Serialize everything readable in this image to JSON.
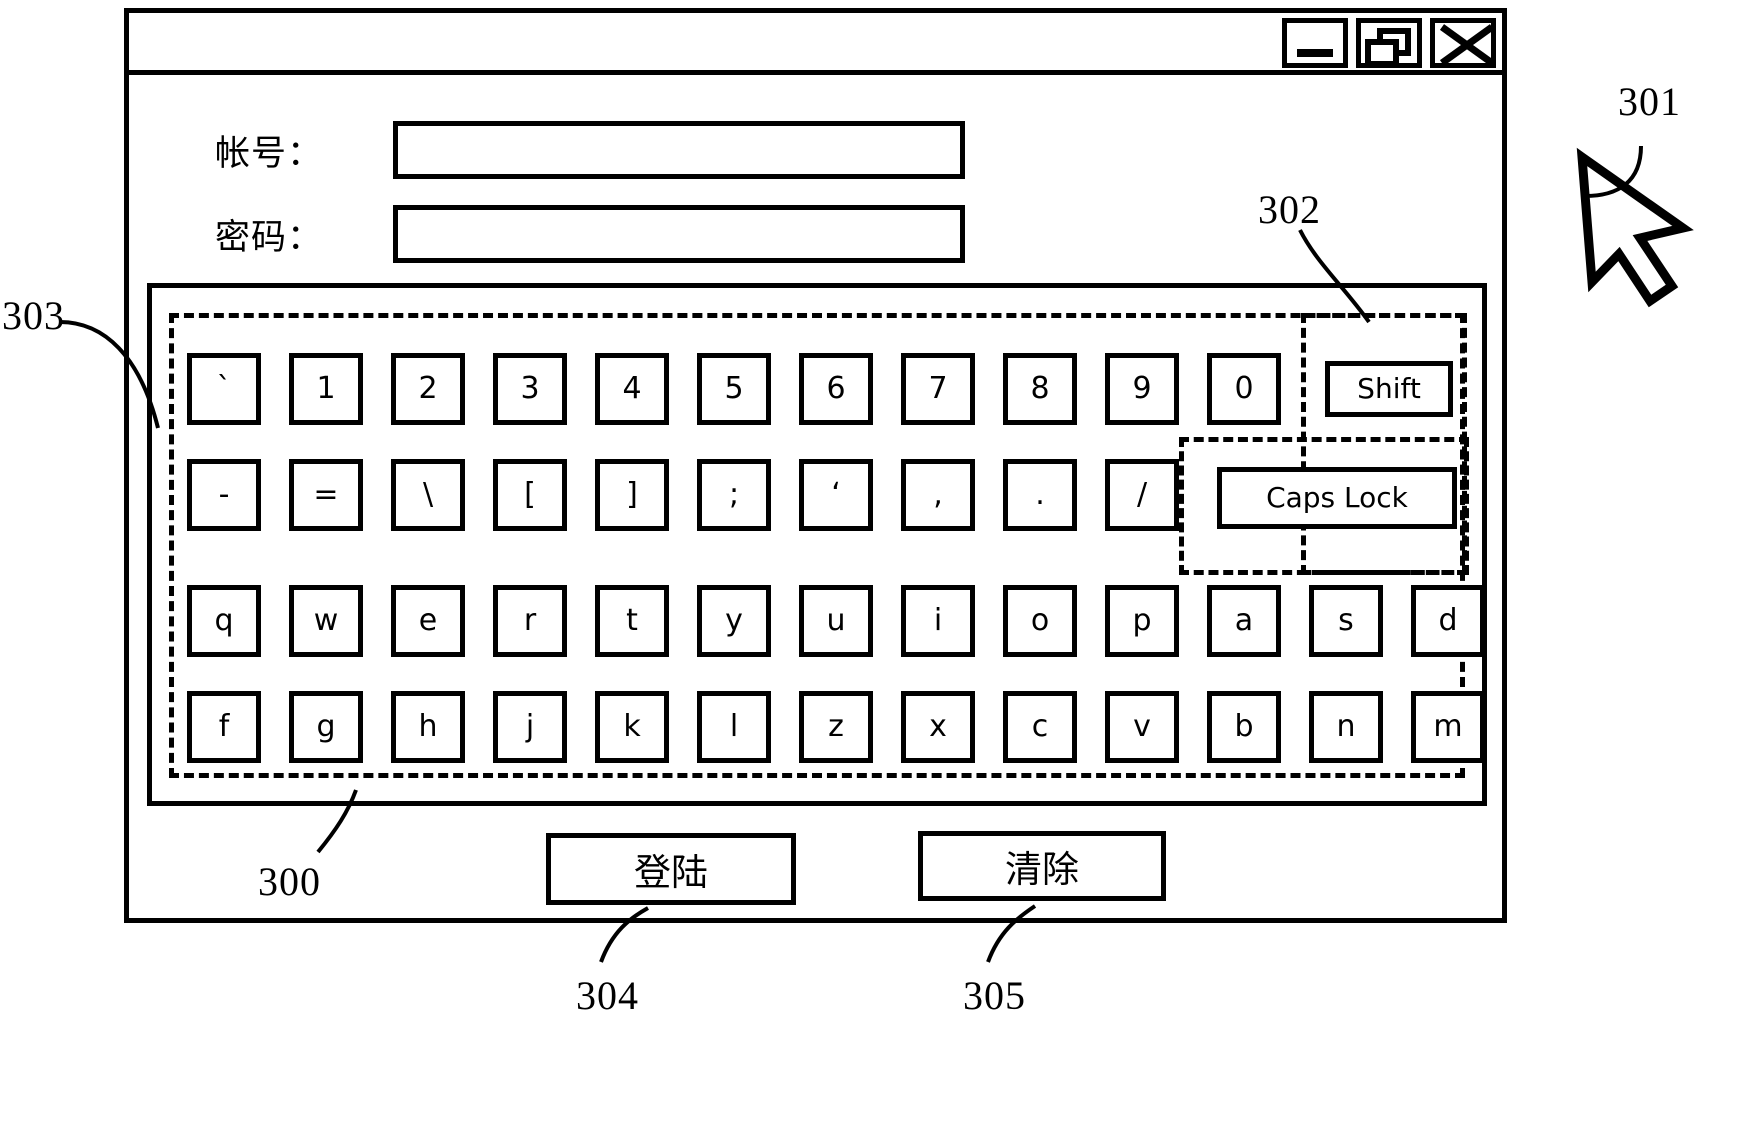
{
  "figure": {
    "type": "patent-drawing",
    "title_visible": false
  },
  "window": {
    "titlebar": {
      "title": "",
      "buttons": [
        {
          "name": "minimize",
          "glyph": "minimize-icon"
        },
        {
          "name": "restore",
          "glyph": "restore-icon"
        },
        {
          "name": "close",
          "glyph": "close-icon"
        }
      ]
    },
    "form": {
      "fields": [
        {
          "label": "帐号：",
          "value": "",
          "placeholder": ""
        },
        {
          "label": "密码：",
          "value": "",
          "placeholder": ""
        }
      ]
    },
    "keyboard": {
      "rows": [
        {
          "id": "row1",
          "keys": [
            "`",
            "1",
            "2",
            "3",
            "4",
            "5",
            "6",
            "7",
            "8",
            "9",
            "0"
          ]
        },
        {
          "id": "row2",
          "keys": [
            "-",
            "=",
            "\\",
            "[",
            "]",
            ";",
            "‘",
            ",",
            ".",
            "/"
          ]
        },
        {
          "id": "row3",
          "keys": [
            "q",
            "w",
            "e",
            "r",
            "t",
            "y",
            "u",
            "i",
            "o",
            "p",
            "a",
            "s",
            "d"
          ]
        },
        {
          "id": "row4",
          "keys": [
            "f",
            "g",
            "h",
            "j",
            "k",
            "l",
            "z",
            "x",
            "c",
            "v",
            "b",
            "n",
            "m"
          ]
        }
      ],
      "modifiers": [
        {
          "id": "shift",
          "label": "Shift"
        },
        {
          "id": "caps",
          "label": "Caps Lock"
        }
      ]
    },
    "actions": [
      {
        "id": "login",
        "label": "登陆"
      },
      {
        "id": "clear",
        "label": "清除"
      }
    ]
  },
  "cursor": {
    "name": "mouse-pointer",
    "label": "301"
  },
  "reference_numerals": [
    {
      "id": "n301",
      "text": "301"
    },
    {
      "id": "n302",
      "text": "302"
    },
    {
      "id": "n303",
      "text": "303"
    },
    {
      "id": "n300",
      "text": "300"
    },
    {
      "id": "n304",
      "text": "304"
    },
    {
      "id": "n305",
      "text": "305"
    }
  ],
  "colors": {
    "ink": "#000000",
    "paper": "#ffffff"
  }
}
